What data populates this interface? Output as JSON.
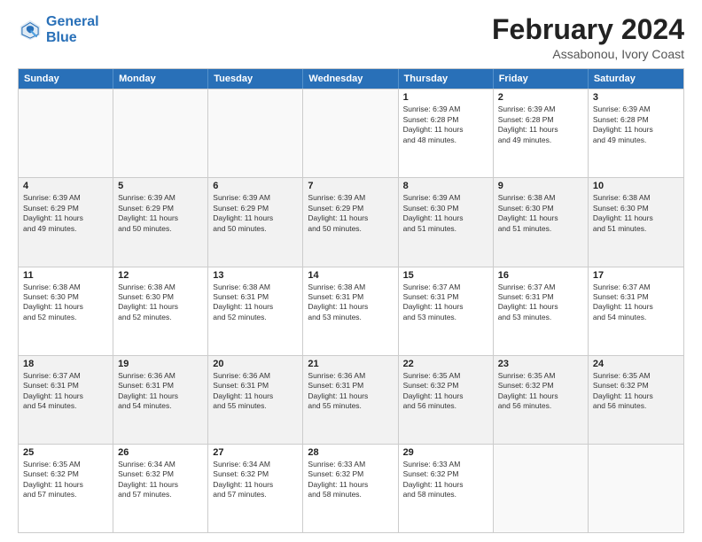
{
  "logo": {
    "line1": "General",
    "line2": "Blue"
  },
  "title": "February 2024",
  "subtitle": "Assabonou, Ivory Coast",
  "header": {
    "days": [
      "Sunday",
      "Monday",
      "Tuesday",
      "Wednesday",
      "Thursday",
      "Friday",
      "Saturday"
    ]
  },
  "weeks": [
    [
      {
        "day": "",
        "info": ""
      },
      {
        "day": "",
        "info": ""
      },
      {
        "day": "",
        "info": ""
      },
      {
        "day": "",
        "info": ""
      },
      {
        "day": "1",
        "info": "Sunrise: 6:39 AM\nSunset: 6:28 PM\nDaylight: 11 hours\nand 48 minutes."
      },
      {
        "day": "2",
        "info": "Sunrise: 6:39 AM\nSunset: 6:28 PM\nDaylight: 11 hours\nand 49 minutes."
      },
      {
        "day": "3",
        "info": "Sunrise: 6:39 AM\nSunset: 6:28 PM\nDaylight: 11 hours\nand 49 minutes."
      }
    ],
    [
      {
        "day": "4",
        "info": "Sunrise: 6:39 AM\nSunset: 6:29 PM\nDaylight: 11 hours\nand 49 minutes."
      },
      {
        "day": "5",
        "info": "Sunrise: 6:39 AM\nSunset: 6:29 PM\nDaylight: 11 hours\nand 50 minutes."
      },
      {
        "day": "6",
        "info": "Sunrise: 6:39 AM\nSunset: 6:29 PM\nDaylight: 11 hours\nand 50 minutes."
      },
      {
        "day": "7",
        "info": "Sunrise: 6:39 AM\nSunset: 6:29 PM\nDaylight: 11 hours\nand 50 minutes."
      },
      {
        "day": "8",
        "info": "Sunrise: 6:39 AM\nSunset: 6:30 PM\nDaylight: 11 hours\nand 51 minutes."
      },
      {
        "day": "9",
        "info": "Sunrise: 6:38 AM\nSunset: 6:30 PM\nDaylight: 11 hours\nand 51 minutes."
      },
      {
        "day": "10",
        "info": "Sunrise: 6:38 AM\nSunset: 6:30 PM\nDaylight: 11 hours\nand 51 minutes."
      }
    ],
    [
      {
        "day": "11",
        "info": "Sunrise: 6:38 AM\nSunset: 6:30 PM\nDaylight: 11 hours\nand 52 minutes."
      },
      {
        "day": "12",
        "info": "Sunrise: 6:38 AM\nSunset: 6:30 PM\nDaylight: 11 hours\nand 52 minutes."
      },
      {
        "day": "13",
        "info": "Sunrise: 6:38 AM\nSunset: 6:31 PM\nDaylight: 11 hours\nand 52 minutes."
      },
      {
        "day": "14",
        "info": "Sunrise: 6:38 AM\nSunset: 6:31 PM\nDaylight: 11 hours\nand 53 minutes."
      },
      {
        "day": "15",
        "info": "Sunrise: 6:37 AM\nSunset: 6:31 PM\nDaylight: 11 hours\nand 53 minutes."
      },
      {
        "day": "16",
        "info": "Sunrise: 6:37 AM\nSunset: 6:31 PM\nDaylight: 11 hours\nand 53 minutes."
      },
      {
        "day": "17",
        "info": "Sunrise: 6:37 AM\nSunset: 6:31 PM\nDaylight: 11 hours\nand 54 minutes."
      }
    ],
    [
      {
        "day": "18",
        "info": "Sunrise: 6:37 AM\nSunset: 6:31 PM\nDaylight: 11 hours\nand 54 minutes."
      },
      {
        "day": "19",
        "info": "Sunrise: 6:36 AM\nSunset: 6:31 PM\nDaylight: 11 hours\nand 54 minutes."
      },
      {
        "day": "20",
        "info": "Sunrise: 6:36 AM\nSunset: 6:31 PM\nDaylight: 11 hours\nand 55 minutes."
      },
      {
        "day": "21",
        "info": "Sunrise: 6:36 AM\nSunset: 6:31 PM\nDaylight: 11 hours\nand 55 minutes."
      },
      {
        "day": "22",
        "info": "Sunrise: 6:35 AM\nSunset: 6:32 PM\nDaylight: 11 hours\nand 56 minutes."
      },
      {
        "day": "23",
        "info": "Sunrise: 6:35 AM\nSunset: 6:32 PM\nDaylight: 11 hours\nand 56 minutes."
      },
      {
        "day": "24",
        "info": "Sunrise: 6:35 AM\nSunset: 6:32 PM\nDaylight: 11 hours\nand 56 minutes."
      }
    ],
    [
      {
        "day": "25",
        "info": "Sunrise: 6:35 AM\nSunset: 6:32 PM\nDaylight: 11 hours\nand 57 minutes."
      },
      {
        "day": "26",
        "info": "Sunrise: 6:34 AM\nSunset: 6:32 PM\nDaylight: 11 hours\nand 57 minutes."
      },
      {
        "day": "27",
        "info": "Sunrise: 6:34 AM\nSunset: 6:32 PM\nDaylight: 11 hours\nand 57 minutes."
      },
      {
        "day": "28",
        "info": "Sunrise: 6:33 AM\nSunset: 6:32 PM\nDaylight: 11 hours\nand 58 minutes."
      },
      {
        "day": "29",
        "info": "Sunrise: 6:33 AM\nSunset: 6:32 PM\nDaylight: 11 hours\nand 58 minutes."
      },
      {
        "day": "",
        "info": ""
      },
      {
        "day": "",
        "info": ""
      }
    ]
  ]
}
